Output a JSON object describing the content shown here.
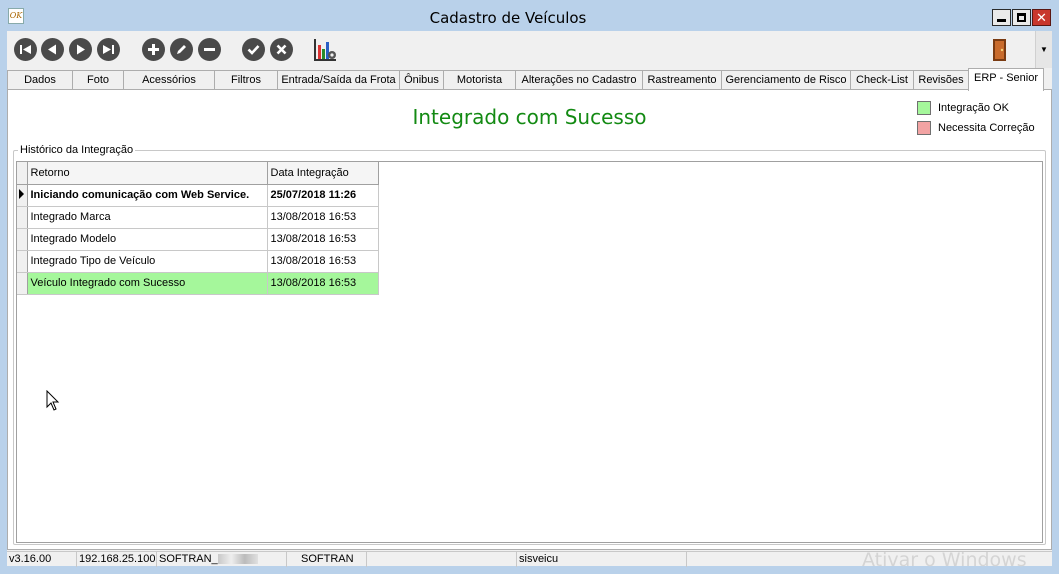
{
  "window": {
    "title": "Cadastro de Veículos",
    "icon_label": "OK"
  },
  "toolbar": {
    "buttons": [
      "first-record-icon",
      "previous-record-icon",
      "next-record-icon",
      "last-record-icon",
      "add-icon",
      "edit-icon",
      "remove-icon",
      "confirm-icon",
      "cancel-icon",
      "chart-settings-icon",
      "exit-door-icon"
    ],
    "dropdown": "▼"
  },
  "tabs": [
    {
      "label": "Dados"
    },
    {
      "label": "Foto"
    },
    {
      "label": "Acessórios"
    },
    {
      "label": "Filtros"
    },
    {
      "label": "Entrada/Saída da Frota"
    },
    {
      "label": "Ônibus"
    },
    {
      "label": "Motorista"
    },
    {
      "label": "Alterações no Cadastro"
    },
    {
      "label": "Rastreamento"
    },
    {
      "label": "Gerenciamento de Risco"
    },
    {
      "label": "Check-List"
    },
    {
      "label": "Revisões"
    },
    {
      "label": "ERP - Senior"
    }
  ],
  "active_tab": "ERP - Senior",
  "panel": {
    "status_message": "Integrado com Sucesso",
    "legend": {
      "ok": {
        "label": "Integração OK",
        "color": "#a5f79b"
      },
      "fix": {
        "label": "Necessita Correção",
        "color": "#f2a3a3"
      }
    },
    "group_title": "Histórico da Integração",
    "grid": {
      "columns": [
        "Retorno",
        "Data Integração"
      ],
      "rows": [
        {
          "retorno": "Iniciando comunicação com Web Service.",
          "data": "25/07/2018 11:26"
        },
        {
          "retorno": "Integrado Marca",
          "data": "13/08/2018 16:53"
        },
        {
          "retorno": "Integrado Modelo",
          "data": "13/08/2018 16:53"
        },
        {
          "retorno": "Integrado Tipo de Veículo",
          "data": "13/08/2018 16:53"
        },
        {
          "retorno": "Veículo Integrado com Sucesso",
          "data": "13/08/2018 16:53"
        }
      ]
    }
  },
  "statusbar": {
    "version": "v3.16.00",
    "ip": "192.168.25.100",
    "database": "SOFTRAN_",
    "user": "SOFTRAN",
    "form": "sisveicu"
  },
  "watermark": "Ativar o Windows"
}
